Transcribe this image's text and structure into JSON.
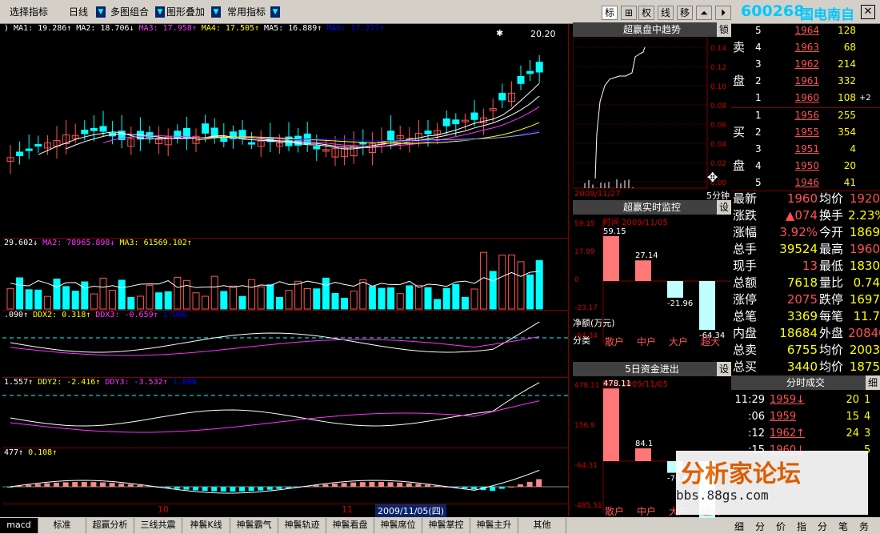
{
  "toolbar": {
    "indicator": "选择指标",
    "period": "日线",
    "multi": "多图组合",
    "overlay": "图形叠加",
    "common": "常用指标",
    "btns": [
      "标",
      "⊞",
      "权",
      "线",
      "移",
      "⏶",
      "⏵"
    ]
  },
  "stock": {
    "code": "600268",
    "name": "国电南自"
  },
  "main_legend": [
    {
      "t": ") MA1: 19.286↑",
      "c": "#fff"
    },
    {
      "t": "MA2: 18.706↓",
      "c": "#fff"
    },
    {
      "t": "MA3: 17.958↑",
      "c": "#f3f"
    },
    {
      "t": "MA4: 17.505↑",
      "c": "#ff0"
    },
    {
      "t": "MA5: 16.889↑",
      "c": "#fff"
    },
    {
      "t": "MA6: 17.277↑",
      "c": "#00f"
    }
  ],
  "vol_legend": [
    {
      "t": "29.602↓",
      "c": "#fff"
    },
    {
      "t": "MA2: 78965.898↓",
      "c": "#f3f"
    },
    {
      "t": "MA3: 61569.102↑",
      "c": "#ff0"
    }
  ],
  "ddx_legend": [
    {
      "t": ".090↑",
      "c": "#fff"
    },
    {
      "t": "DDX2: 0.318↑",
      "c": "#ff0"
    },
    {
      "t": "DDX3: -0.659↑",
      "c": "#f3f"
    },
    {
      "t": "1.000",
      "c": "#00f"
    }
  ],
  "ddy_legend": [
    {
      "t": "1.557↑",
      "c": "#fff"
    },
    {
      "t": "DDY2: -2.416↑",
      "c": "#ff0"
    },
    {
      "t": "DDY3: -3.532↑",
      "c": "#f3f"
    },
    {
      "t": "1.000",
      "c": "#00f"
    }
  ],
  "macd_legend": [
    {
      "t": "477↑",
      "c": "#fff"
    },
    {
      "t": "0.108↑",
      "c": "#ff0"
    }
  ],
  "price_high": "20.20",
  "dates": {
    "m10": "10",
    "m11": "11",
    "cursor": "2009/11/05(四)"
  },
  "tabs": [
    "macd",
    "标准",
    "超赢分析",
    "三线共震",
    "神鬟K线",
    "神鬟霸气",
    "神鬟轨迹",
    "神鬟看盘",
    "神鬟席位",
    "神鬟掌控",
    "神鬟主升",
    "其他"
  ],
  "trend": {
    "title": "超赢盘中趋势",
    "btn": "锁",
    "date": "2009/11/27",
    "period": "5分钟",
    "yticks": [
      "0.14",
      "0.12",
      "0.10",
      "0.08",
      "0.06",
      "0.04",
      "0.02",
      "0.00"
    ]
  },
  "monitor": {
    "title": "超赢实时监控",
    "btn": "设",
    "time": "时间  2009/11/05",
    "yticks": [
      "59.15",
      "17.99",
      "0",
      "-23.17",
      "-64.34"
    ],
    "netlabel": "净额(万元)",
    "cat": "分类",
    "cats": [
      "散户",
      "中户",
      "大户",
      "超大"
    ],
    "values": [
      59.15,
      27.14,
      -21.96,
      -64.34
    ]
  },
  "fund5": {
    "title": "5日资金进出",
    "btn": "设",
    "time": "时间  2009/11/05",
    "yticks": [
      "478.11",
      "156.9",
      "-64.31",
      "-485.51"
    ],
    "cats": [
      "散户",
      "中户",
      "大户",
      "超大"
    ],
    "values": [
      478.11,
      84.1,
      -76.69,
      -485.51
    ]
  },
  "sell": [
    {
      "i": "5",
      "p": "1964",
      "v": "128"
    },
    {
      "i": "4",
      "p": "1963",
      "v": "68"
    },
    {
      "i": "3",
      "p": "1962",
      "v": "214"
    },
    {
      "i": "2",
      "p": "1961",
      "v": "332"
    },
    {
      "i": "1",
      "p": "1960",
      "v": "108",
      "x": "+2"
    }
  ],
  "buy": [
    {
      "i": "1",
      "p": "1956",
      "v": "255"
    },
    {
      "i": "2",
      "p": "1955",
      "v": "354"
    },
    {
      "i": "3",
      "p": "1951",
      "v": "4"
    },
    {
      "i": "4",
      "p": "1950",
      "v": "20"
    },
    {
      "i": "5",
      "p": "1946",
      "v": "41"
    }
  ],
  "sell_label": [
    "卖",
    "盘"
  ],
  "buy_label": [
    "买",
    "盘"
  ],
  "stats": [
    {
      "l1": "最新",
      "v1": "1960",
      "l2": "均价",
      "v2": "1920",
      "c1": "red",
      "c2": "red"
    },
    {
      "l1": "涨跌",
      "v1": "▲074",
      "l2": "换手",
      "v2": "2.23%",
      "c1": "red",
      "c2": ""
    },
    {
      "l1": "涨幅",
      "v1": "3.92%",
      "l2": "今开",
      "v2": "1869",
      "c1": "red",
      "c2": ""
    },
    {
      "l1": "总手",
      "v1": "39524",
      "l2": "最高",
      "v2": "1960",
      "c1": "",
      "c2": "red"
    },
    {
      "l1": "现手",
      "v1": "13",
      "l2": "最低",
      "v2": "1830",
      "c1": "red",
      "c2": ""
    },
    {
      "l1": "总额",
      "v1": "7618",
      "l2": "量比",
      "v2": "0.74",
      "c1": "",
      "c2": ""
    },
    {
      "l1": "涨停",
      "v1": "2075",
      "l2": "跌停",
      "v2": "1697",
      "c1": "red",
      "c2": ""
    },
    {
      "l1": "总笔",
      "v1": "3369",
      "l2": "每笔",
      "v2": "11.7",
      "c1": "",
      "c2": ""
    },
    {
      "l1": "内盘",
      "v1": "18684",
      "l2": "外盘",
      "v2": "20840",
      "c1": "",
      "c2": "red"
    },
    {
      "l1": "总卖",
      "v1": "6755",
      "l2": "均价",
      "v2": "2003",
      "c1": "",
      "c2": ""
    },
    {
      "l1": "总买",
      "v1": "3440",
      "l2": "均价",
      "v2": "1875",
      "c1": "",
      "c2": ""
    }
  ],
  "ticks_title": "分时成交",
  "ticks_btn": "细",
  "ticks": [
    {
      "t": "11:29",
      "p": "1959↓",
      "v": "20",
      "d": "1"
    },
    {
      "t": ":06",
      "p": "1959",
      "v": "15",
      "d": "4"
    },
    {
      "t": ":12",
      "p": "1962↑",
      "v": "24",
      "d": "3"
    },
    {
      "t": ":15",
      "p": "1960↓",
      "v": "",
      "d": "5"
    }
  ],
  "bottom": [
    "细",
    "分",
    "价",
    "指",
    "分",
    "笔",
    "务"
  ],
  "watermark": {
    "title": "分析家论坛",
    "url": "bbs.88gs.com"
  }
}
